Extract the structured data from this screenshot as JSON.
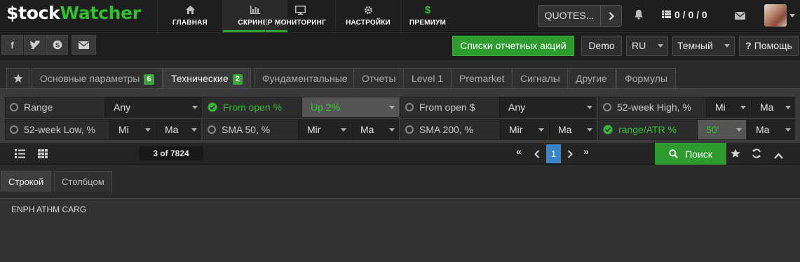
{
  "logo": {
    "part1": "$tock",
    "part2": "Watcher"
  },
  "nav": [
    {
      "label": "ГЛАВНАЯ",
      "icon": "home-icon"
    },
    {
      "label": "СКРИНЕР",
      "icon": "chart-bars-icon"
    },
    {
      "label": "МОНИТОРИНГ",
      "icon": "monitor-icon"
    },
    {
      "label": "НАСТРОЙКИ",
      "icon": "gear-icon"
    },
    {
      "label": "ПРЕМИУМ",
      "icon": "dollar-icon",
      "glyph": "$"
    }
  ],
  "header": {
    "quotes_label": "QUOTES...",
    "counter": "0 / 0 / 0"
  },
  "toolbar": {
    "stock_lists": "Списки отчетных акций",
    "demo": "Demo",
    "lang": "RU",
    "theme": "Темный",
    "help": "Помощь"
  },
  "tabs": [
    {
      "label": "Основные параметры",
      "badge": "6"
    },
    {
      "label": "Технические",
      "badge": "2"
    },
    {
      "label": "Фундаментальные"
    },
    {
      "label": "Отчеты"
    },
    {
      "label": "Level 1"
    },
    {
      "label": "Premarket"
    },
    {
      "label": "Сигналы"
    },
    {
      "label": "Другие"
    },
    {
      "label": "Формулы"
    }
  ],
  "filters": {
    "range": {
      "label": "Range",
      "value": "Any"
    },
    "from_open_pct": {
      "label": "From open %",
      "value": "Up 2%"
    },
    "from_open_usd": {
      "label": "From open $",
      "value": "Any"
    },
    "week52_high": {
      "label": "52-week High, %",
      "min": "Mi",
      "max": "Ma"
    },
    "week52_low": {
      "label": "52-week Low, %",
      "min": "Mi",
      "max": "Ma"
    },
    "sma50": {
      "label": "SMA 50, %",
      "min": "Mir",
      "max": "Ma"
    },
    "sma200": {
      "label": "SMA 200, %",
      "min": "Mir",
      "max": "Ma"
    },
    "range_atr": {
      "label": "range/ATR %",
      "min": "50'",
      "max": "Ma"
    }
  },
  "pager": {
    "summary": "3 of 7824",
    "current": "1",
    "search": "Поиск"
  },
  "view_tabs": [
    "Строкой",
    "Столбцом"
  ],
  "result": {
    "tickers": "ENPH ATHM CARG"
  },
  "colors": {
    "accent_green": "#2d9b2d",
    "active_text_green": "#35b935",
    "page_blue": "#3a86c8"
  }
}
